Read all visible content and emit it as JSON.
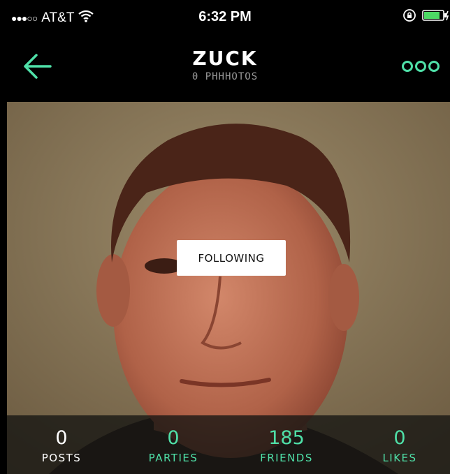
{
  "status_bar": {
    "signal": "●●●○○",
    "carrier": "AT&T",
    "time": "6:32 PM"
  },
  "nav": {
    "title": "ZUCK",
    "subtitle": "0 PHHHOTOS",
    "back_icon": "arrow-left-icon",
    "more_icon": "more-dots-icon"
  },
  "photo": {
    "follow_button_label": "FOLLOWING"
  },
  "stats": [
    {
      "value": "0",
      "label": "POSTS",
      "color": "#ffffff"
    },
    {
      "value": "0",
      "label": "PARTIES",
      "color": "#4fe0a8"
    },
    {
      "value": "185",
      "label": "FRIENDS",
      "color": "#4fe0a8"
    },
    {
      "value": "0",
      "label": "LIKES",
      "color": "#4fe0a8"
    }
  ],
  "colors": {
    "accent": "#4fe0a8",
    "background": "#000000"
  }
}
